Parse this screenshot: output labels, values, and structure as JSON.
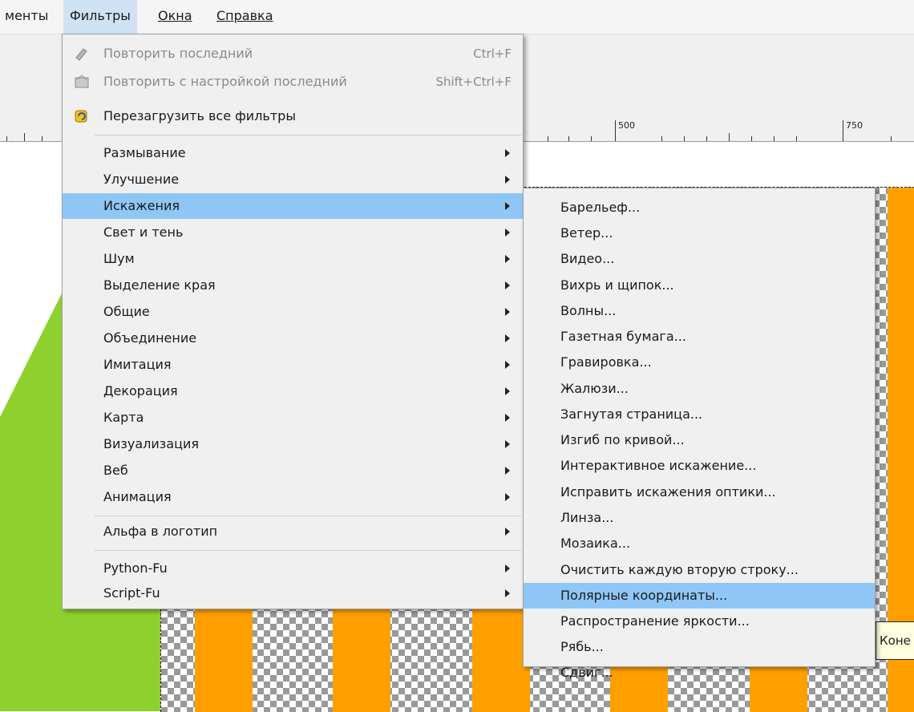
{
  "menubar": {
    "items": [
      {
        "label": "менты",
        "active": false
      },
      {
        "label": "Фильтры",
        "active": true
      },
      {
        "label": "Окна",
        "active": false
      },
      {
        "label": "Справка",
        "active": false
      }
    ]
  },
  "ruler": {
    "labels": [
      "500",
      "750"
    ]
  },
  "filters_menu": {
    "top_items": [
      {
        "label": "Повторить последний",
        "shortcut": "Ctrl+F",
        "disabled": true,
        "icon": "repeat-filter-icon"
      },
      {
        "label": "Повторить с настройкой последний",
        "shortcut": "Shift+Ctrl+F",
        "disabled": true,
        "icon": "reshow-filter-icon"
      },
      {
        "label": "Перезагрузить все фильтры",
        "shortcut": "",
        "disabled": false,
        "icon": "reload-filters-icon"
      }
    ],
    "categories": [
      {
        "label": "Размывание",
        "highlighted": false
      },
      {
        "label": "Улучшение",
        "highlighted": false
      },
      {
        "label": "Искажения",
        "highlighted": true
      },
      {
        "label": "Свет и тень",
        "highlighted": false
      },
      {
        "label": "Шум",
        "highlighted": false
      },
      {
        "label": "Выделение края",
        "highlighted": false
      },
      {
        "label": "Общие",
        "highlighted": false
      },
      {
        "label": "Объединение",
        "highlighted": false
      },
      {
        "label": "Имитация",
        "highlighted": false
      },
      {
        "label": "Декорация",
        "highlighted": false
      },
      {
        "label": "Карта",
        "highlighted": false
      },
      {
        "label": "Визуализация",
        "highlighted": false
      },
      {
        "label": "Веб",
        "highlighted": false
      },
      {
        "label": "Анимация",
        "highlighted": false
      }
    ],
    "alpha_item": {
      "label": "Альфа в логотип"
    },
    "script_items": [
      {
        "label": "Python-Fu"
      },
      {
        "label": "Script-Fu"
      }
    ]
  },
  "distorts_submenu": {
    "items": [
      {
        "label": "Барельеф...",
        "highlighted": false
      },
      {
        "label": "Ветер...",
        "highlighted": false
      },
      {
        "label": "Видео...",
        "highlighted": false
      },
      {
        "label": "Вихрь и щипок...",
        "highlighted": false
      },
      {
        "label": "Волны...",
        "highlighted": false
      },
      {
        "label": "Газетная бумага...",
        "highlighted": false
      },
      {
        "label": "Гравировка...",
        "highlighted": false
      },
      {
        "label": "Жалюзи...",
        "highlighted": false
      },
      {
        "label": "Загнутая страница...",
        "highlighted": false
      },
      {
        "label": "Изгиб по кривой...",
        "highlighted": false
      },
      {
        "label": "Интерактивное искажение...",
        "highlighted": false
      },
      {
        "label": "Исправить искажения оптики...",
        "highlighted": false
      },
      {
        "label": "Линза...",
        "highlighted": false
      },
      {
        "label": "Мозаика...",
        "highlighted": false
      },
      {
        "label": "Очистить каждую вторую строку...",
        "highlighted": false
      },
      {
        "label": "Полярные координаты...",
        "highlighted": true
      },
      {
        "label": "Распространение яркости...",
        "highlighted": false
      },
      {
        "label": "Рябь...",
        "highlighted": false
      },
      {
        "label": "Сдвиг...",
        "highlighted": false
      }
    ]
  },
  "tooltip": {
    "text": "Коне"
  },
  "colors": {
    "highlight": "#8ec7f5",
    "menubar_active": "#cfe3f5",
    "orange": "#ffa000",
    "green": "#8ed12e"
  }
}
